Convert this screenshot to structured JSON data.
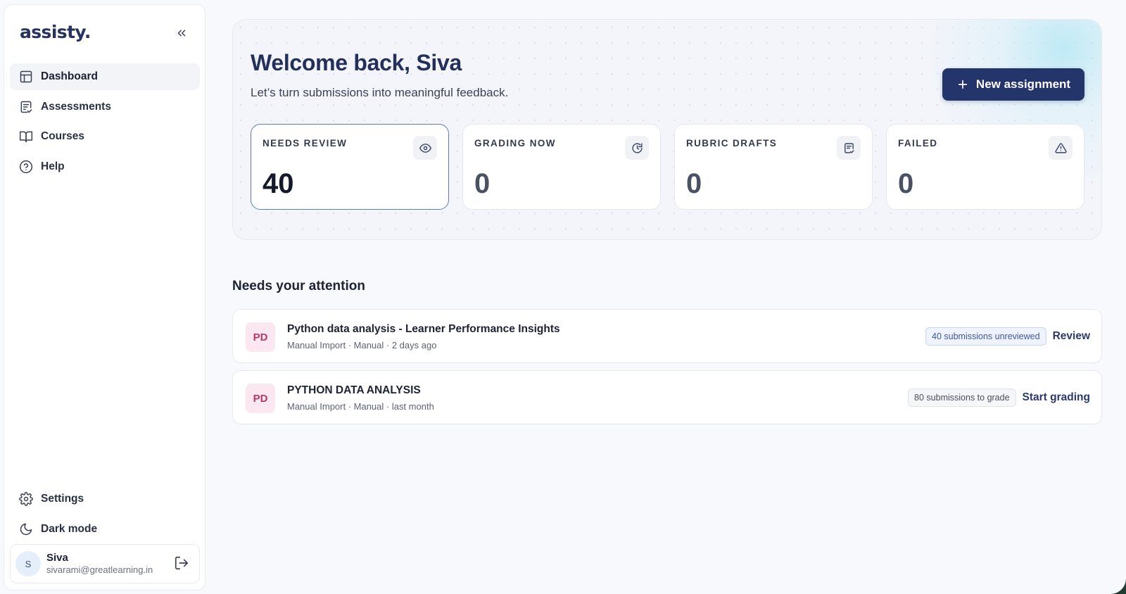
{
  "brand": {
    "logo": "assisty."
  },
  "sidebar": {
    "nav": [
      {
        "label": "Dashboard",
        "icon": "layout-icon",
        "active": true
      },
      {
        "label": "Assessments",
        "icon": "clipboard-check-icon"
      },
      {
        "label": "Courses",
        "icon": "book-open-icon"
      },
      {
        "label": "Help",
        "icon": "help-circle-icon"
      }
    ],
    "bottom": [
      {
        "label": "Settings",
        "icon": "gear-icon"
      },
      {
        "label": "Dark mode",
        "icon": "moon-icon"
      }
    ],
    "user": {
      "initial": "S",
      "name": "Siva",
      "email": "sivarami@greatlearning.in"
    }
  },
  "hero": {
    "title": "Welcome back, Siva",
    "subtitle": "Let’s turn submissions into meaningful feedback.",
    "new_button": "New assignment"
  },
  "stats": [
    {
      "label": "NEEDS REVIEW",
      "value": "40",
      "icon": "eye-icon",
      "active": true
    },
    {
      "label": "GRADING NOW",
      "value": "0",
      "icon": "clock-refresh-icon"
    },
    {
      "label": "RUBRIC DRAFTS",
      "value": "0",
      "icon": "document-check-icon"
    },
    {
      "label": "FAILED",
      "value": "0",
      "icon": "warning-triangle-icon"
    }
  ],
  "attention": {
    "title": "Needs your attention",
    "items": [
      {
        "initials": "PD",
        "title": "Python data analysis - Learner Performance Insights",
        "meta": "Manual Import · Manual · 2 days ago",
        "pill": "40 submissions unreviewed",
        "action": "Review"
      },
      {
        "initials": "PD",
        "title": "PYTHON DATA ANALYSIS",
        "meta": "Manual Import · Manual · last month",
        "pill": "80 submissions to grade",
        "action": "Start grading"
      }
    ]
  },
  "colors": {
    "primary": "#24356b",
    "accent_border": "#5d7bc0",
    "badge_bg": "#fbe7ef",
    "badge_text": "#b33a6a"
  }
}
